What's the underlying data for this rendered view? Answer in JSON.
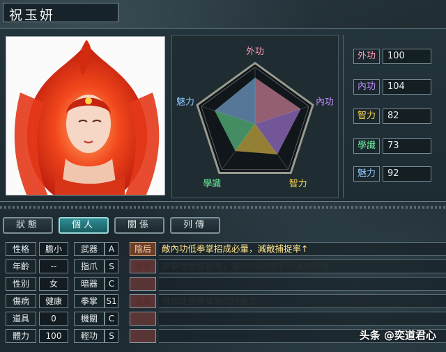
{
  "character": {
    "name": "祝玉妍"
  },
  "radar": {
    "axes": [
      {
        "label": "外功",
        "value": 100,
        "color": "#ff9dba"
      },
      {
        "label": "內功",
        "value": 104,
        "color": "#c58cff"
      },
      {
        "label": "智力",
        "value": 82,
        "color": "#ffd84a"
      },
      {
        "label": "學識",
        "value": 73,
        "color": "#6ff0a0"
      },
      {
        "label": "魅力",
        "value": 92,
        "color": "#8fc8ff"
      }
    ]
  },
  "stats": [
    {
      "label": "外功",
      "value": "100",
      "color": "#ff9dba"
    },
    {
      "label": "內功",
      "value": "104",
      "color": "#c58cff"
    },
    {
      "label": "智力",
      "value": "82",
      "color": "#ffd84a"
    },
    {
      "label": "學識",
      "value": "73",
      "color": "#6ff0a0"
    },
    {
      "label": "魅力",
      "value": "92",
      "color": "#8fc8ff"
    }
  ],
  "tabs": [
    {
      "label": "狀態"
    },
    {
      "label": "個人"
    },
    {
      "label": "關係"
    },
    {
      "label": "列傳"
    }
  ],
  "personal": [
    {
      "label": "性格",
      "value": "膽小"
    },
    {
      "label": "年齡",
      "value": "--"
    },
    {
      "label": "性別",
      "value": "女"
    },
    {
      "label": "傷病",
      "value": "健康"
    },
    {
      "label": "道具",
      "value": "0"
    },
    {
      "label": "體力",
      "value": "100"
    }
  ],
  "arts": [
    {
      "label": "武器",
      "grade": "A"
    },
    {
      "label": "指爪",
      "grade": "S"
    },
    {
      "label": "暗器",
      "grade": "C"
    },
    {
      "label": "拳掌",
      "grade": "S1"
    },
    {
      "label": "機關",
      "grade": "C"
    },
    {
      "label": "輕功",
      "grade": "S"
    }
  ],
  "skills": [
    {
      "tag": "陰后",
      "desc": "敵內功低拳掌招成必暈，減敵捕捉率↑",
      "state": "on"
    },
    {
      "tag": "拳手",
      "desc": "攻擊使敵移動時，有50%的機率可讓敵負傷",
      "state": "dim"
    },
    {
      "tag": "",
      "desc": "",
      "state": "blank"
    },
    {
      "tag": "追風",
      "desc": "增加使用拳掌時的移動力",
      "state": "dim"
    },
    {
      "tag": "",
      "desc": "",
      "state": "blank"
    },
    {
      "tag": "",
      "desc": "",
      "state": "blank"
    }
  ],
  "watermark": "头条 @奕道君心"
}
